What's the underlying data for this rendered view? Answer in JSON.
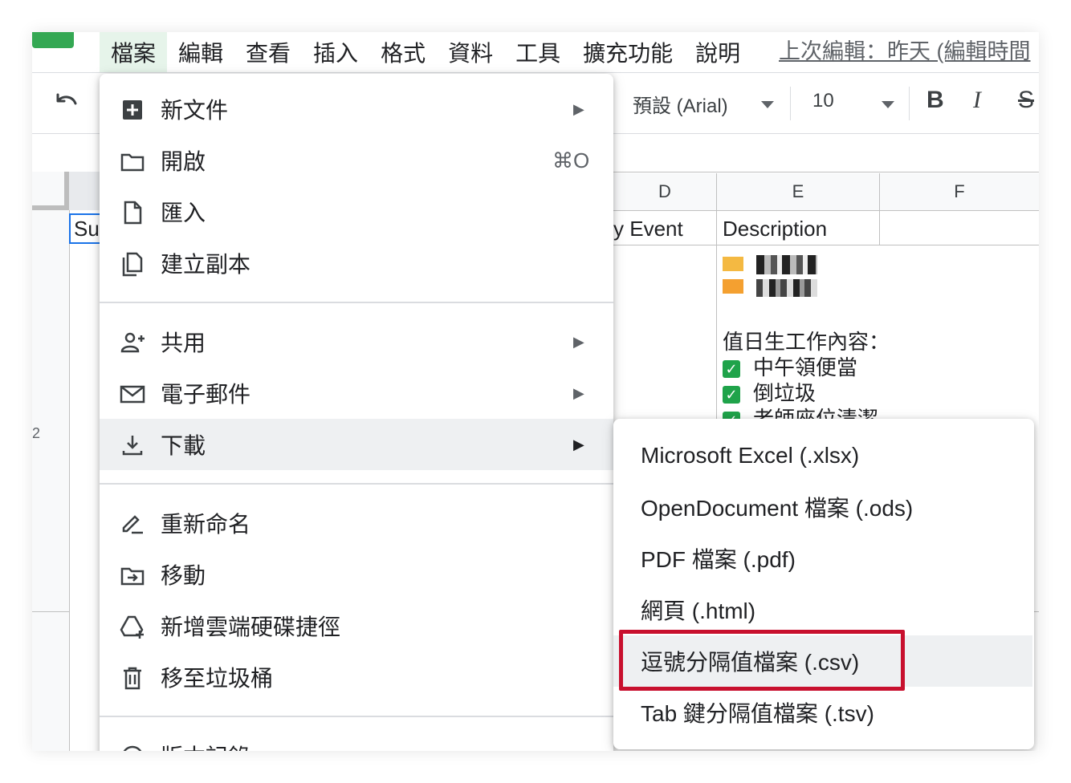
{
  "menubar": {
    "items": [
      "檔案",
      "編輯",
      "查看",
      "插入",
      "格式",
      "資料",
      "工具",
      "擴充功能",
      "說明"
    ],
    "last_edit": "上次編輯：昨天 (編輯時間"
  },
  "toolbar": {
    "font": "預設 (Arial)",
    "font_size": "10",
    "bold": "B",
    "italic": "I",
    "strike": "S"
  },
  "sheet": {
    "columns": [
      "D",
      "E",
      "F"
    ],
    "cell_a1": "Su",
    "header_d": "y Event",
    "header_e": "Description",
    "row_num": "2",
    "duty_title": "值日生工作內容：",
    "duty_items": [
      "中午領便當",
      "倒垃圾",
      "老師座位清潔"
    ],
    "check_glyph": "✓"
  },
  "file_menu": {
    "items": [
      {
        "label": "新文件",
        "icon": "new-doc-icon",
        "submenu": true
      },
      {
        "label": "開啟",
        "icon": "folder-icon",
        "shortcut": "⌘O"
      },
      {
        "label": "匯入",
        "icon": "file-icon"
      },
      {
        "label": "建立副本",
        "icon": "copy-icon"
      },
      {
        "label": "共用",
        "icon": "share-person-icon",
        "submenu": true
      },
      {
        "label": "電子郵件",
        "icon": "mail-icon",
        "submenu": true
      },
      {
        "label": "下載",
        "icon": "download-icon",
        "submenu": true,
        "highlighted": true
      },
      {
        "label": "重新命名",
        "icon": "rename-icon"
      },
      {
        "label": "移動",
        "icon": "move-folder-icon"
      },
      {
        "label": "新增雲端硬碟捷徑",
        "icon": "drive-shortcut-icon"
      },
      {
        "label": "移至垃圾桶",
        "icon": "trash-icon"
      },
      {
        "label": "版本記錄",
        "icon": "history-icon",
        "submenu": true
      }
    ],
    "submenu_arrow": "▶"
  },
  "download_menu": {
    "items": [
      "Microsoft Excel (.xlsx)",
      "OpenDocument 檔案 (.ods)",
      "PDF 檔案 (.pdf)",
      "網頁 (.html)",
      "逗號分隔值檔案 (.csv)",
      "Tab 鍵分隔值檔案 (.tsv)"
    ],
    "highlighted_index": 4
  },
  "colors": {
    "accent_green": "#34a853",
    "highlight_red": "#c8102e",
    "menu_hover": "#eef0f2"
  }
}
